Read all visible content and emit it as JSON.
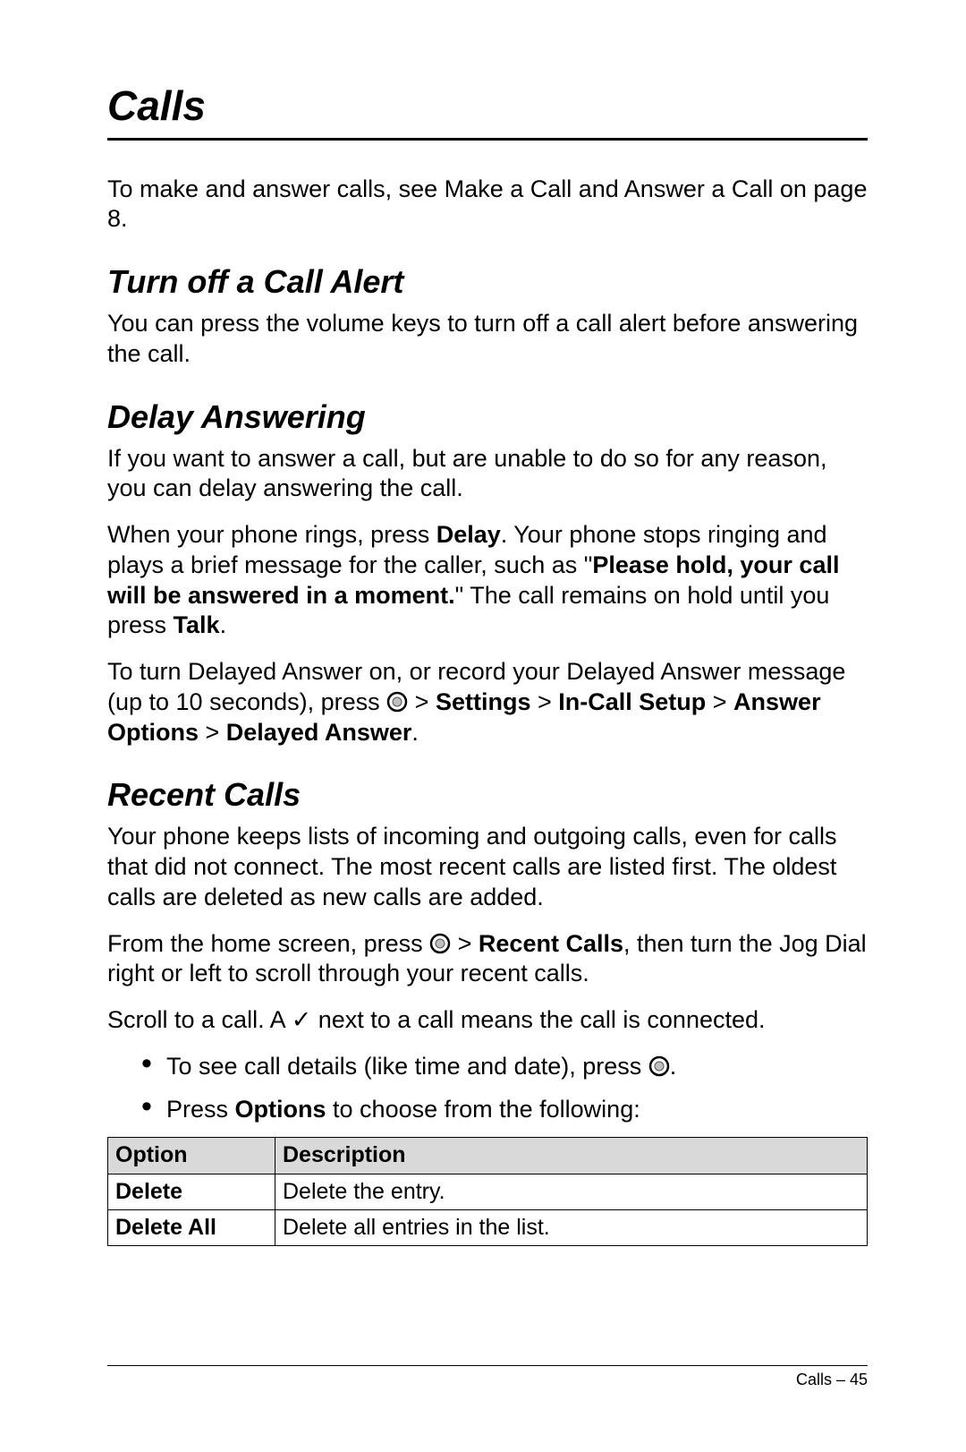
{
  "title": "Calls",
  "intro": "To make and answer calls, see Make a Call and Answer a Call on page 8.",
  "s1": {
    "heading": "Turn off a Call Alert",
    "body": "You can press the volume keys to turn off a call alert before answering the call."
  },
  "s2": {
    "heading": "Delay Answering",
    "p1": "If you want to answer a call, but are unable to do so for any reason, you can delay answering the call.",
    "p2a": "When your phone rings, press ",
    "delay": "Delay",
    "p2b": ". Your phone stops ringing and plays a brief message for the caller, such as \"",
    "hold_msg": "Please hold, your call will be answered in a moment.",
    "p2c": "\" The call remains on hold until you press ",
    "talk": "Talk",
    "p2d": ".",
    "p3a": "To turn Delayed Answer on, or record your Delayed Answer message (up to 10 seconds), press ",
    "gt": " > ",
    "nav1": "Settings",
    "nav2": "In-Call Setup",
    "nav3": "Answer Options",
    "nav4": "Delayed Answer",
    "p3end": "."
  },
  "s3": {
    "heading": "Recent Calls",
    "p1": "Your phone keeps lists of incoming and outgoing calls, even for calls that did not connect. The most recent calls are listed first. The oldest calls are deleted as new calls are added.",
    "p2a": "From the home screen, press ",
    "gt": " > ",
    "recent": "Recent Calls",
    "p2b": ", then turn the Jog Dial right or left to scroll through your recent calls.",
    "p3a": "Scroll to a call. A ",
    "check": "✓",
    "p3b": " next to a call means the call is connected.",
    "b1a": "To see call details (like time and date), press ",
    "b1b": ".",
    "b2a": "Press ",
    "options": "Options",
    "b2b": " to choose from the following:"
  },
  "table": {
    "h1": "Option",
    "h2": "Description",
    "r1o": "Delete",
    "r1d": "Delete the entry.",
    "r2o": "Delete All",
    "r2d": "Delete all entries in the list."
  },
  "footer": "Calls – 45"
}
